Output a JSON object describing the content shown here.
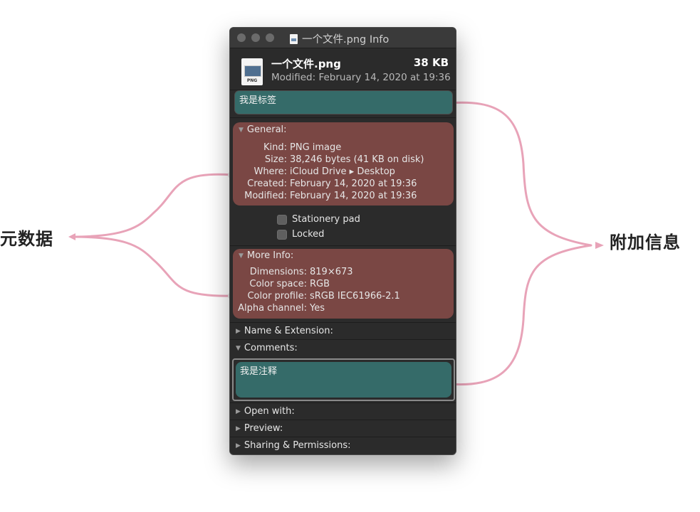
{
  "annotations": {
    "left_label": "元数据",
    "right_label": "附加信息",
    "bracket_color": "#e8a3b8"
  },
  "window": {
    "title": "一个文件.png Info",
    "header": {
      "file_name": "一个文件.png",
      "file_size": "38 KB",
      "modified": "Modified: February 14, 2020 at 19:36",
      "icon_ext": "PNG"
    },
    "tags": {
      "value": "我是标签"
    },
    "general": {
      "heading": "General:",
      "rows": [
        {
          "label": "Kind:",
          "value": "PNG image"
        },
        {
          "label": "Size:",
          "value": "38,246 bytes (41 KB on disk)"
        },
        {
          "label": "Where:",
          "value": "iCloud Drive ▸ Desktop"
        },
        {
          "label": "Created:",
          "value": "February 14, 2020 at 19:36"
        },
        {
          "label": "Modified:",
          "value": "February 14, 2020 at 19:36"
        }
      ],
      "checkboxes": [
        {
          "label": "Stationery pad",
          "checked": false
        },
        {
          "label": "Locked",
          "checked": false
        }
      ]
    },
    "more_info": {
      "heading": "More Info:",
      "rows": [
        {
          "label": "Dimensions:",
          "value": "819×673"
        },
        {
          "label": "Color space:",
          "value": "RGB"
        },
        {
          "label": "Color profile:",
          "value": "sRGB IEC61966-2.1"
        },
        {
          "label": "Alpha channel:",
          "value": "Yes"
        }
      ]
    },
    "name_extension": {
      "heading": "Name & Extension:"
    },
    "comments": {
      "heading": "Comments:",
      "value": "我是注释"
    },
    "open_with": {
      "heading": "Open with:"
    },
    "preview": {
      "heading": "Preview:"
    },
    "sharing": {
      "heading": "Sharing & Permissions:"
    },
    "colors": {
      "metadata_highlight": "#7a4744",
      "extra_info_highlight": "#356b69",
      "window_bg": "#2b2b2b"
    }
  }
}
